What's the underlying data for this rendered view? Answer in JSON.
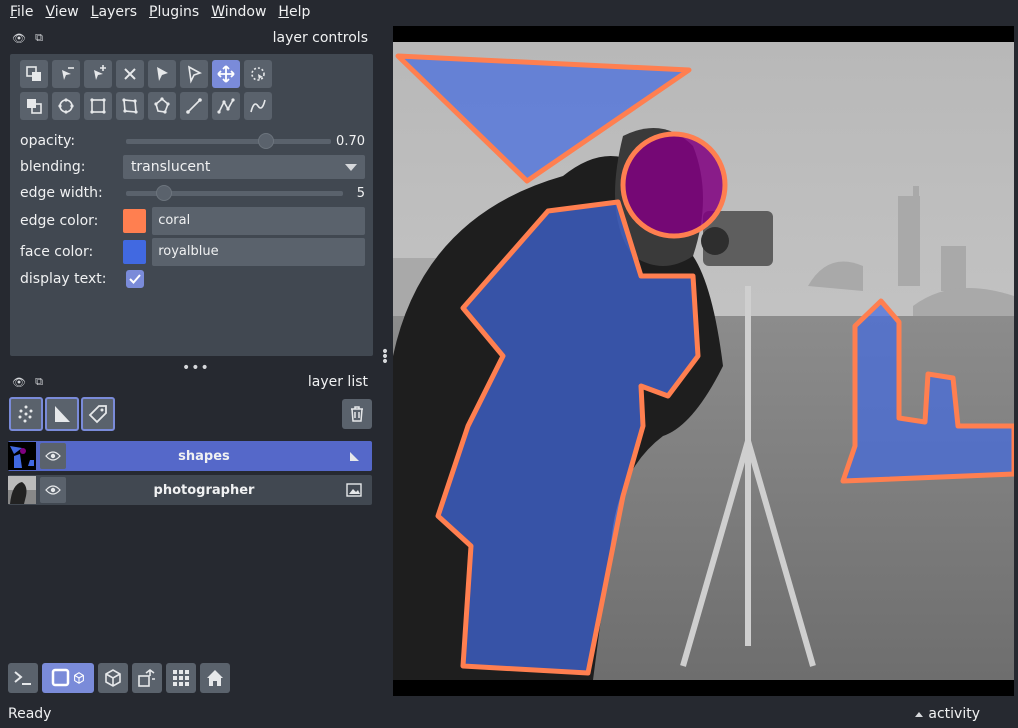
{
  "menubar": {
    "items": [
      {
        "first": "F",
        "rest": "ile"
      },
      {
        "first": "V",
        "rest": "iew"
      },
      {
        "first": "L",
        "rest": "ayers"
      },
      {
        "first": "P",
        "rest": "lugins"
      },
      {
        "first": "W",
        "rest": "indow"
      },
      {
        "first": "H",
        "rest": "elp"
      }
    ]
  },
  "layer_controls": {
    "title": "layer controls",
    "opacity": {
      "label": "opacity:",
      "value": "0.70",
      "fraction": 0.7
    },
    "blending": {
      "label": "blending:",
      "value": "translucent"
    },
    "edge_width": {
      "label": "edge width:",
      "value": "5",
      "fraction": 0.15
    },
    "edge_color": {
      "label": "edge color:",
      "value": "coral",
      "swatch": "#ff7f50"
    },
    "face_color": {
      "label": "face color:",
      "value": "royalblue",
      "swatch": "#4169e1"
    },
    "display_text": {
      "label": "display text:",
      "checked": true
    },
    "tools": [
      "move-front-icon",
      "remove-vertex-icon",
      "add-vertex-icon",
      "delete-shape-icon",
      "select-icon",
      "direct-select-icon",
      "pan-zoom-icon",
      "lasso-select-icon",
      "move-back-icon",
      "add-ellipse-icon",
      "add-rectangle-icon",
      "add-polygon-icon",
      "add-polygon-lasso-icon",
      "add-line-icon",
      "add-path-icon",
      "add-polyline-icon"
    ],
    "active_tool": "pan-zoom-icon"
  },
  "layer_list": {
    "title": "layer list",
    "layers": [
      {
        "name": "shapes",
        "type": "shapes",
        "selected": true
      },
      {
        "name": "photographer",
        "type": "image",
        "selected": false
      }
    ]
  },
  "status": {
    "text": "Ready",
    "activity": "activity"
  },
  "colors": {
    "background": "#262930",
    "panel": "#414851",
    "button": "#5a626c",
    "accent": "#7a8bd9",
    "selected_layer": "#5568c9",
    "edge": "#ff7f50",
    "face": "#4169e1"
  }
}
